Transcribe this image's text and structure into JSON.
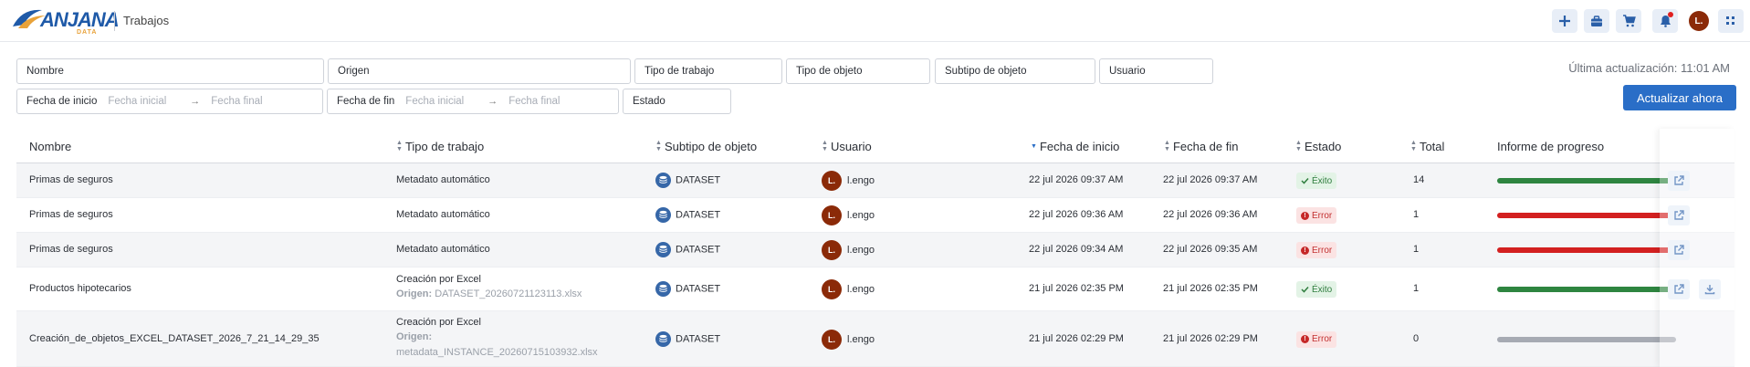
{
  "header": {
    "logo_text": "ANJANA",
    "logo_sub": "DATA",
    "title": "Trabajos",
    "user_initial": "L.",
    "colors": {
      "accent": "#2a6ec7",
      "brand": "#1f5aa8",
      "avatar": "#8b2a08"
    }
  },
  "filters": {
    "nombre": "Nombre",
    "origen": "Origen",
    "tipo_trabajo": "Tipo de trabajo",
    "tipo_objeto": "Tipo de objeto",
    "subtipo_objeto": "Subtipo de objeto",
    "usuario": "Usuario",
    "fecha_inicio": {
      "label": "Fecha de inicio",
      "from": "Fecha inicial",
      "to": "Fecha final"
    },
    "fecha_fin": {
      "label": "Fecha de fin",
      "from": "Fecha inicial",
      "to": "Fecha final"
    },
    "estado": "Estado"
  },
  "last_update": "Última actualización: 11:01 AM",
  "refresh_label": "Actualizar ahora",
  "table": {
    "columns": [
      "Nombre",
      "Tipo de trabajo",
      "Subtipo de objeto",
      "Usuario",
      "Fecha de inicio",
      "Fecha de fin",
      "Estado",
      "Total",
      "Informe de progreso"
    ],
    "rows": [
      {
        "nombre": "Primas de seguros",
        "tipo": "Metadato automático",
        "origen_label": "",
        "origen": "",
        "subtipo": "DATASET",
        "usuario": "l.engo",
        "inicio": "22 jul 2026 09:37 AM",
        "fin": "22 jul 2026 09:37 AM",
        "estado": "Éxito",
        "status": "ok",
        "total": "14",
        "progress_color": "#2e8540",
        "actions": [
          "open"
        ]
      },
      {
        "nombre": "Primas de seguros",
        "tipo": "Metadato automático",
        "origen_label": "",
        "origen": "",
        "subtipo": "DATASET",
        "usuario": "l.engo",
        "inicio": "22 jul 2026 09:36 AM",
        "fin": "22 jul 2026 09:36 AM",
        "estado": "Error",
        "status": "err",
        "total": "1",
        "progress_color": "#d32020",
        "actions": [
          "open"
        ]
      },
      {
        "nombre": "Primas de seguros",
        "tipo": "Metadato automático",
        "origen_label": "",
        "origen": "",
        "subtipo": "DATASET",
        "usuario": "l.engo",
        "inicio": "22 jul 2026 09:34 AM",
        "fin": "22 jul 2026 09:35 AM",
        "estado": "Error",
        "status": "err",
        "total": "1",
        "progress_color": "#d32020",
        "actions": [
          "open"
        ]
      },
      {
        "nombre": "Productos hipotecarios",
        "tipo": "Creación por Excel",
        "origen_label": "Origen:",
        "origen": "DATASET_20260721123113.xlsx",
        "subtipo": "DATASET",
        "usuario": "l.engo",
        "inicio": "21 jul 2026 02:35 PM",
        "fin": "21 jul 2026 02:35 PM",
        "estado": "Éxito",
        "status": "ok",
        "total": "1",
        "progress_color": "#2e8540",
        "actions": [
          "open",
          "download"
        ]
      },
      {
        "nombre": "Creación_de_objetos_EXCEL_DATASET_2026_7_21_14_29_35",
        "tipo": "Creación por Excel",
        "origen_label": "Origen:",
        "origen": "metadata_INSTANCE_20260715103932.xlsx",
        "subtipo": "DATASET",
        "usuario": "l.engo",
        "inicio": "21 jul 2026 02:29 PM",
        "fin": "21 jul 2026 02:29 PM",
        "estado": "Error",
        "status": "err",
        "total": "0",
        "progress_color": "#a6aab3",
        "actions": []
      }
    ]
  }
}
